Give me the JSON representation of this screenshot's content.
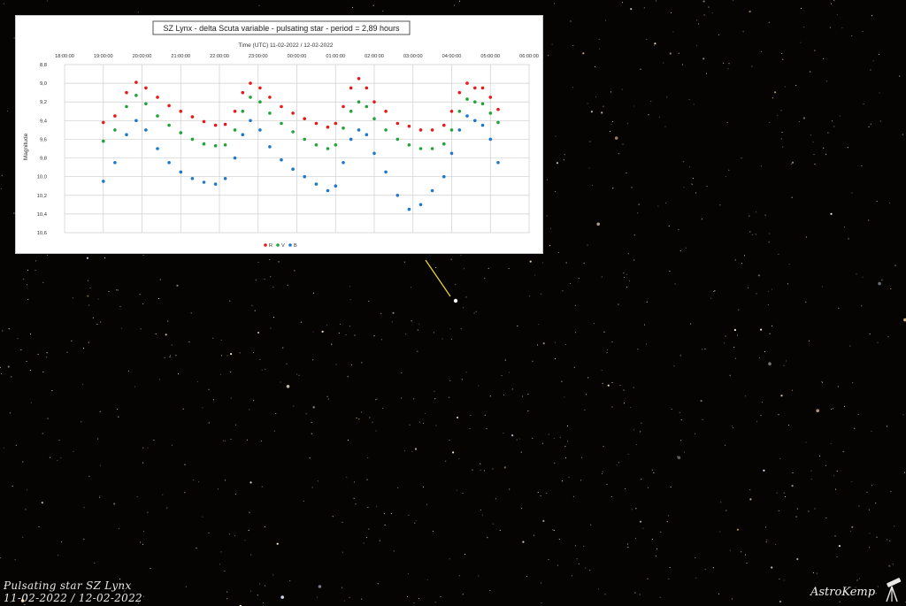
{
  "caption": {
    "line1": "Pulsating star SZ Lynx",
    "line2": "11-02-2022 / 12-02-2022"
  },
  "signature": "AstroKemp",
  "colors": {
    "R": "#e8191c",
    "V": "#1fa33a",
    "B": "#1f78c8",
    "pointer": "#e6d23a"
  },
  "chart_data": {
    "type": "scatter",
    "title": "SZ Lynx - delta Scuta variable - pulsating star - period = 2,89 hours",
    "xlabel": "Time (UTC) 11-02-2022 / 12-02-2022",
    "ylabel": "Magnitude",
    "x_ticks": [
      "18:00:00",
      "19:00:00",
      "20:00:00",
      "21:00:00",
      "22:00:00",
      "23:00:00",
      "00:00:00",
      "01:00:00",
      "02:00:00",
      "03:00:00",
      "04:00:00",
      "05:00:00",
      "06:00:00"
    ],
    "y_ticks": [
      "8,8",
      "9,0",
      "9,2",
      "9,4",
      "9,6",
      "9,8",
      "10,0",
      "10,2",
      "10,4",
      "10,6"
    ],
    "ylim": [
      8.8,
      10.6
    ],
    "y_inverted": true,
    "grid": true,
    "legend_position": "bottom-center",
    "legend": [
      "R",
      "V",
      "B"
    ],
    "series": [
      {
        "name": "R",
        "x_hours": [
          19.0,
          19.3,
          19.6,
          19.85,
          20.1,
          20.4,
          20.7,
          21.0,
          21.3,
          21.6,
          21.9,
          22.15,
          22.4,
          22.6,
          22.8,
          23.05,
          23.3,
          23.6,
          23.9,
          24.2,
          24.5,
          24.8,
          25.0,
          25.2,
          25.4,
          25.6,
          25.8,
          26.0,
          26.3,
          26.6,
          26.9,
          27.2,
          27.5,
          27.8,
          28.0,
          28.2,
          28.4,
          28.6,
          28.8,
          29.0,
          29.2
        ],
        "values": [
          9.42,
          9.35,
          9.1,
          8.99,
          9.05,
          9.15,
          9.24,
          9.3,
          9.36,
          9.41,
          9.45,
          9.44,
          9.3,
          9.1,
          9.0,
          9.05,
          9.15,
          9.25,
          9.32,
          9.38,
          9.43,
          9.47,
          9.43,
          9.25,
          9.05,
          8.95,
          9.05,
          9.2,
          9.3,
          9.43,
          9.46,
          9.5,
          9.5,
          9.45,
          9.3,
          9.1,
          9.0,
          9.05,
          9.05,
          9.15,
          9.28
        ]
      },
      {
        "name": "V",
        "x_hours": [
          19.0,
          19.3,
          19.6,
          19.85,
          20.1,
          20.4,
          20.7,
          21.0,
          21.3,
          21.6,
          21.9,
          22.15,
          22.4,
          22.6,
          22.8,
          23.05,
          23.3,
          23.6,
          23.9,
          24.2,
          24.5,
          24.8,
          25.0,
          25.2,
          25.4,
          25.6,
          25.8,
          26.0,
          26.3,
          26.6,
          26.9,
          27.2,
          27.5,
          27.8,
          28.0,
          28.2,
          28.4,
          28.6,
          28.8,
          29.0,
          29.2
        ],
        "values": [
          9.62,
          9.5,
          9.25,
          9.13,
          9.22,
          9.35,
          9.45,
          9.53,
          9.6,
          9.65,
          9.67,
          9.66,
          9.5,
          9.3,
          9.15,
          9.2,
          9.32,
          9.43,
          9.52,
          9.6,
          9.66,
          9.7,
          9.66,
          9.48,
          9.3,
          9.2,
          9.25,
          9.38,
          9.5,
          9.6,
          9.66,
          9.7,
          9.7,
          9.65,
          9.5,
          9.3,
          9.17,
          9.2,
          9.22,
          9.32,
          9.42
        ]
      },
      {
        "name": "B",
        "x_hours": [
          19.0,
          19.3,
          19.6,
          19.85,
          20.1,
          20.4,
          20.7,
          21.0,
          21.3,
          21.6,
          21.9,
          22.15,
          22.4,
          22.6,
          22.8,
          23.05,
          23.3,
          23.6,
          23.9,
          24.2,
          24.5,
          24.8,
          25.0,
          25.2,
          25.4,
          25.6,
          25.8,
          26.0,
          26.3,
          26.6,
          26.9,
          27.2,
          27.5,
          27.8,
          28.0,
          28.2,
          28.4,
          28.6,
          28.8,
          29.0,
          29.2
        ],
        "values": [
          10.05,
          9.85,
          9.55,
          9.4,
          9.5,
          9.7,
          9.85,
          9.95,
          10.02,
          10.06,
          10.08,
          10.02,
          9.8,
          9.55,
          9.4,
          9.5,
          9.68,
          9.82,
          9.92,
          10.0,
          10.08,
          10.15,
          10.1,
          9.85,
          9.6,
          9.5,
          9.55,
          9.75,
          9.95,
          10.2,
          10.35,
          10.3,
          10.15,
          10.0,
          9.75,
          9.5,
          9.35,
          9.4,
          9.45,
          9.6,
          9.85
        ]
      }
    ]
  }
}
